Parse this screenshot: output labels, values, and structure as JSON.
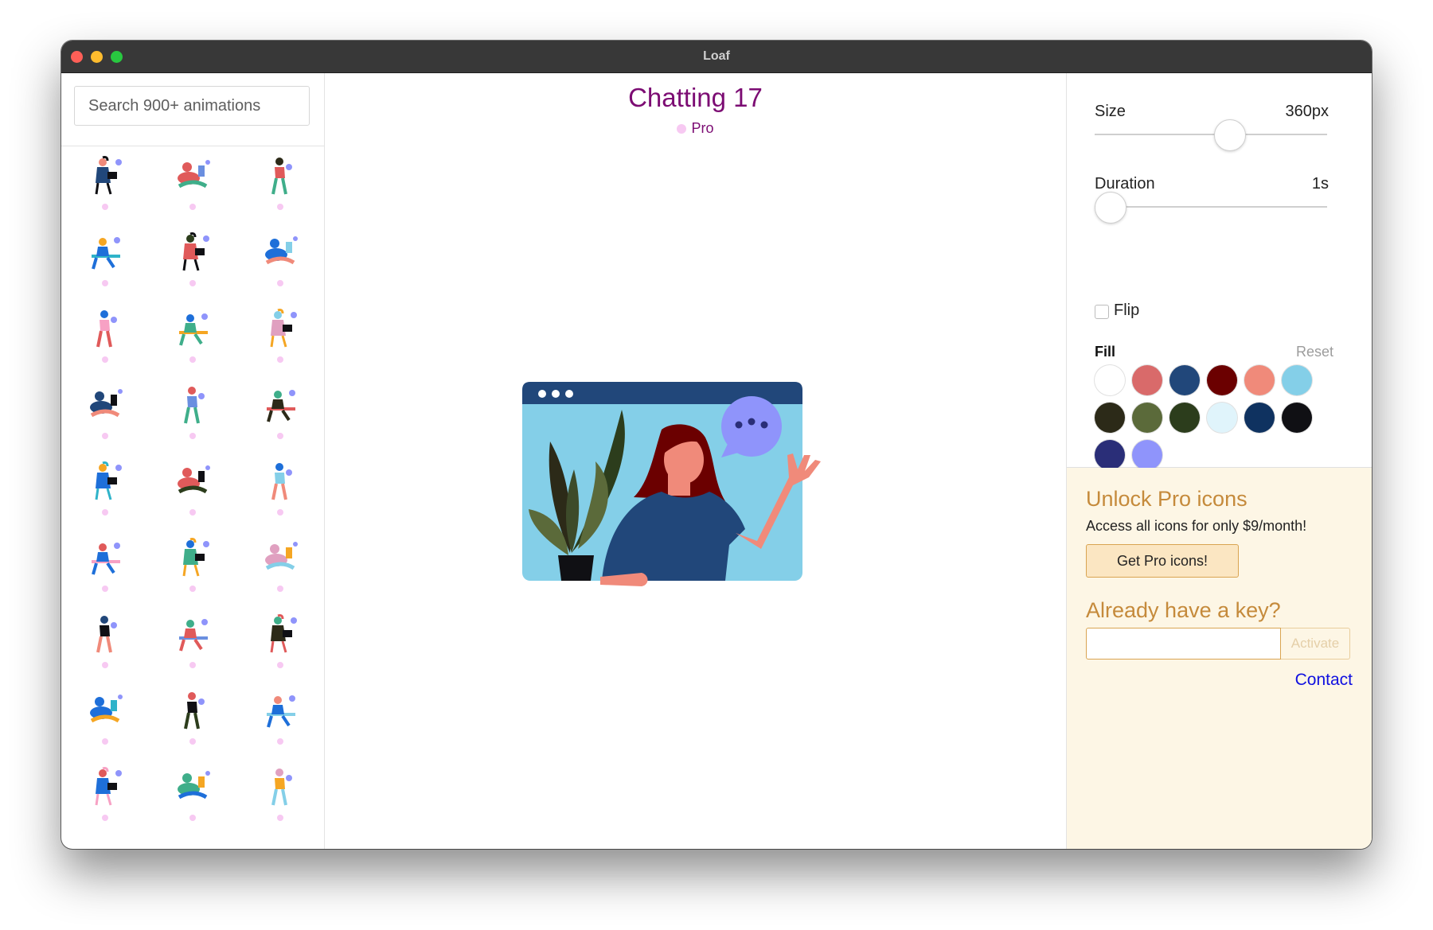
{
  "window": {
    "title": "Loaf"
  },
  "sidebar": {
    "search_placeholder": "Search 900+ animations",
    "thumbnails": [
      "person-laptop",
      "person-reading",
      "person-standing",
      "person-walking",
      "person-reclining",
      "person-sitting",
      "person-desk",
      "person-laptop",
      "person-desk-chair",
      "person-laptop",
      "person-walking",
      "person-meditating",
      "person-video-call",
      "person-lying",
      "person-lying",
      "person-lying",
      "person-sitting",
      "person-sitting",
      "person-dancing",
      "person-walking",
      "person-laptop",
      "person-reading",
      "person-standing",
      "person-walking",
      "person-reclining",
      "person-sitting",
      "person-desk"
    ]
  },
  "preview": {
    "title": "Chatting 17",
    "badge": "Pro"
  },
  "controls": {
    "size_label": "Size",
    "size_value": "360px",
    "size_fraction": 0.59,
    "duration_label": "Duration",
    "duration_value": "1s",
    "duration_fraction": 0.0,
    "flip_label": "Flip",
    "flip_checked": false,
    "fill_label": "Fill",
    "reset_label": "Reset",
    "fill_colors": [
      "#ffffff",
      "#d96a6a",
      "#21477a",
      "#6b0000",
      "#f08a7a",
      "#84cfe8",
      "#2c2a18",
      "#5b6a3a",
      "#2c3d1c",
      "#e0f4fb",
      "#0f3260",
      "#101014",
      "#2a2e78",
      "#8f94fb"
    ]
  },
  "pro": {
    "title": "Unlock Pro icons",
    "description": "Access all icons for only $9/month!",
    "button_label": "Get Pro icons!",
    "key_title": "Already have a key?",
    "key_value": "",
    "activate_label": "Activate",
    "contact_label": "Contact"
  },
  "colors": {
    "title_purple": "#7c0c73",
    "pro_gold": "#c58a3b",
    "pro_background": "#fdf6e5",
    "link_blue": "#1010e0"
  }
}
